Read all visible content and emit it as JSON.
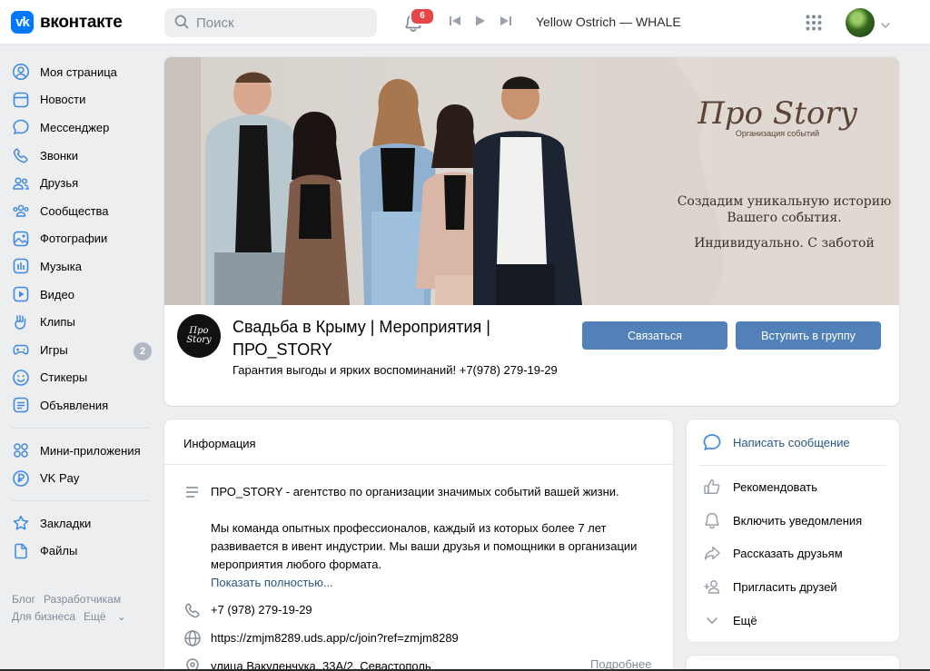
{
  "header": {
    "logo_mark": "vk",
    "logo_text": "вконтакте",
    "search_placeholder": "Поиск",
    "notifications_count": "6",
    "now_playing": "Yellow Ostrich — WHALE",
    "icons": [
      "search-icon",
      "bell-icon",
      "previous-icon",
      "play-icon",
      "next-icon",
      "apps-grid-icon",
      "chevron-down-icon"
    ]
  },
  "sidebar": {
    "items": [
      {
        "label": "Моя страница",
        "icon": "user-circle-icon"
      },
      {
        "label": "Новости",
        "icon": "news-icon"
      },
      {
        "label": "Мессенджер",
        "icon": "message-icon"
      },
      {
        "label": "Звонки",
        "icon": "phone-icon"
      },
      {
        "label": "Друзья",
        "icon": "friends-icon"
      },
      {
        "label": "Сообщества",
        "icon": "communities-icon"
      },
      {
        "label": "Фотографии",
        "icon": "photo-icon"
      },
      {
        "label": "Музыка",
        "icon": "music-icon"
      },
      {
        "label": "Видео",
        "icon": "video-icon"
      },
      {
        "label": "Клипы",
        "icon": "clips-icon"
      },
      {
        "label": "Игры",
        "icon": "games-icon",
        "count": "2"
      },
      {
        "label": "Стикеры",
        "icon": "sticker-icon"
      },
      {
        "label": "Объявления",
        "icon": "ads-icon"
      }
    ],
    "items2": [
      {
        "label": "Мини-приложения",
        "icon": "mini-apps-icon"
      },
      {
        "label": "VK Pay",
        "icon": "vk-pay-icon"
      }
    ],
    "items3": [
      {
        "label": "Закладки",
        "icon": "star-icon"
      },
      {
        "label": "Файлы",
        "icon": "file-icon"
      }
    ],
    "footer": {
      "blog": "Блог",
      "developers": "Разработчикам",
      "business": "Для бизнеса",
      "more": "Ещё"
    }
  },
  "cover": {
    "logo_big": "Про Story",
    "logo_small": "Организация событий",
    "slogan_line1": "Создадим уникальную историю",
    "slogan_line2": "Вашего события.",
    "slogan_line3": "Индивидуально. С заботой"
  },
  "group": {
    "avatar_text": "Про Story",
    "name": "Свадьба в Крыму | Мероприятия | ПРО_STORY",
    "status": "Гарантия выгоды и ярких воспоминаний! +7(978) 279-19-29",
    "contact_button": "Связаться",
    "join_button": "Вступить в группу"
  },
  "info": {
    "title": "Информация",
    "description_1": "ПРО_STORY - агентство по организации значимых событий вашей жизни.",
    "description_2": "Мы команда опытных профессионалов, каждый из которых более 7 лет развивается в ивент индустрии. Мы ваши друзья и помощники в организации мероприятия любого формата.",
    "show_more": "Показать полностью...",
    "phone": "+7 (978) 279-19-29",
    "website": "https://zmjm8289.uds.app/c/join?ref=zmjm8289",
    "address": "улица Вакуленчука, 33А/2, Севастополь",
    "address_more": "Подробнее"
  },
  "actions": {
    "write_message": "Написать сообщение",
    "recommend": "Рекомендовать",
    "notify": "Включить уведомления",
    "share": "Рассказать друзьям",
    "invite": "Пригласить друзей",
    "more": "Ещё"
  },
  "colors": {
    "accent": "#5181b8",
    "link": "#2a5885",
    "vk_blue": "#0077ff",
    "background": "#edeef0",
    "badge": "#e64646"
  }
}
